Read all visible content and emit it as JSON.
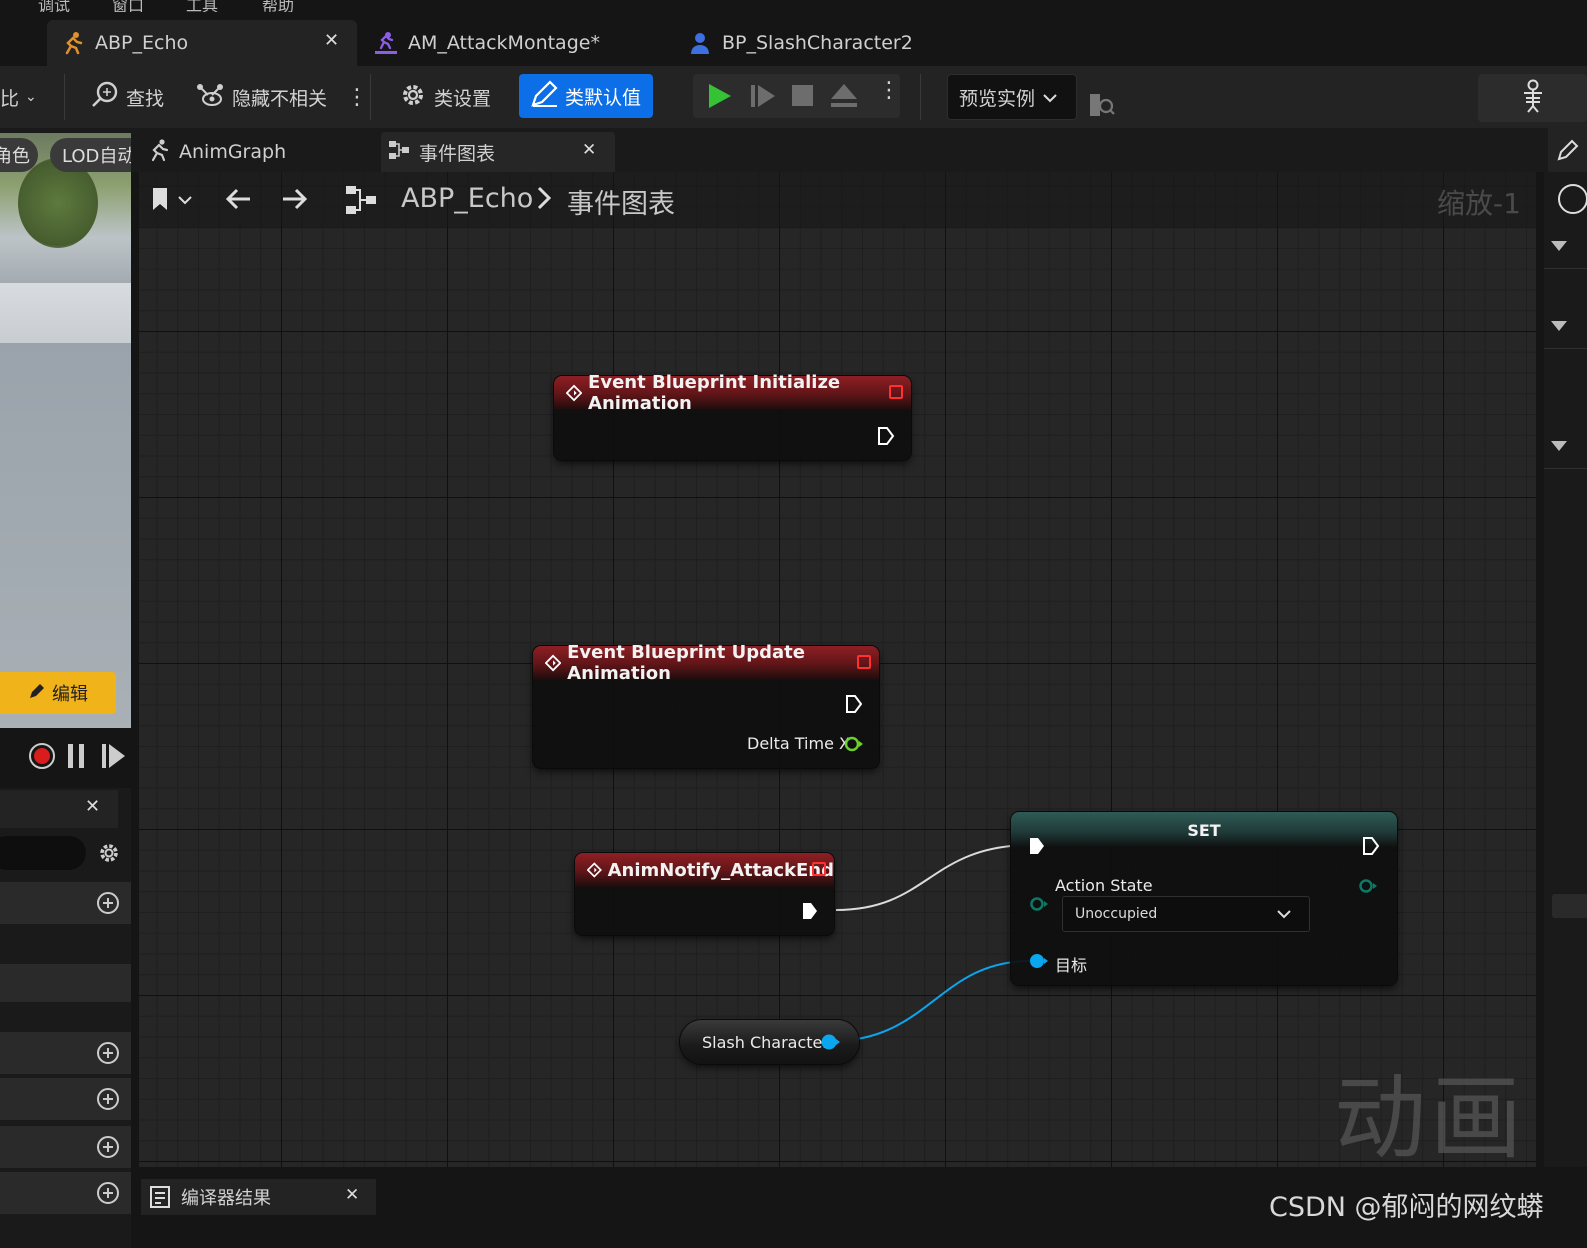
{
  "menu": {
    "items": [
      "调试",
      "窗口",
      "工具",
      "帮助"
    ]
  },
  "doc_tabs": [
    {
      "label": "ABP_Echo",
      "active": true
    },
    {
      "label": "AM_AttackMontage*",
      "active": false
    },
    {
      "label": "BP_SlashCharacter2",
      "active": false
    }
  ],
  "toolbar": {
    "left_cut_label": "比",
    "find": "查找",
    "hide_unrelated": "隐藏不相关",
    "class_settings": "类设置",
    "class_defaults": "类默认值",
    "preview_instance": "预览实例"
  },
  "left_panel": {
    "role_chip": "角色",
    "lod_chip": "LOD自动",
    "edit_button": "编辑"
  },
  "graph_tabs": [
    {
      "label": "AnimGraph"
    },
    {
      "label": "事件图表"
    }
  ],
  "breadcrumb": {
    "root": "ABP_Echo",
    "current": "事件图表",
    "zoom": "缩放-1"
  },
  "nodes": {
    "init": {
      "title": "Event Blueprint Initialize Animation"
    },
    "update": {
      "title": "Event Blueprint Update Animation",
      "pin": "Delta Time X"
    },
    "notify": {
      "title": "AnimNotify_AttackEnd"
    },
    "set": {
      "title": "SET",
      "var": "Action State",
      "value": "Unoccupied",
      "target": "目标"
    },
    "getter": {
      "label": "Slash Character"
    }
  },
  "watermark": "动画",
  "compiler_tab": "编译器结果",
  "credit": "CSDN @郁闷的网纹蟒",
  "colors": {
    "accent_blue": "#0d6fe8",
    "edit_yellow": "#f0b31a",
    "event_red": "#8e1f24",
    "exec_white": "#ffffff",
    "object_pin": "#0aa6ee",
    "enum_pin": "#0b7a66",
    "float_pin": "#6ad12c"
  }
}
